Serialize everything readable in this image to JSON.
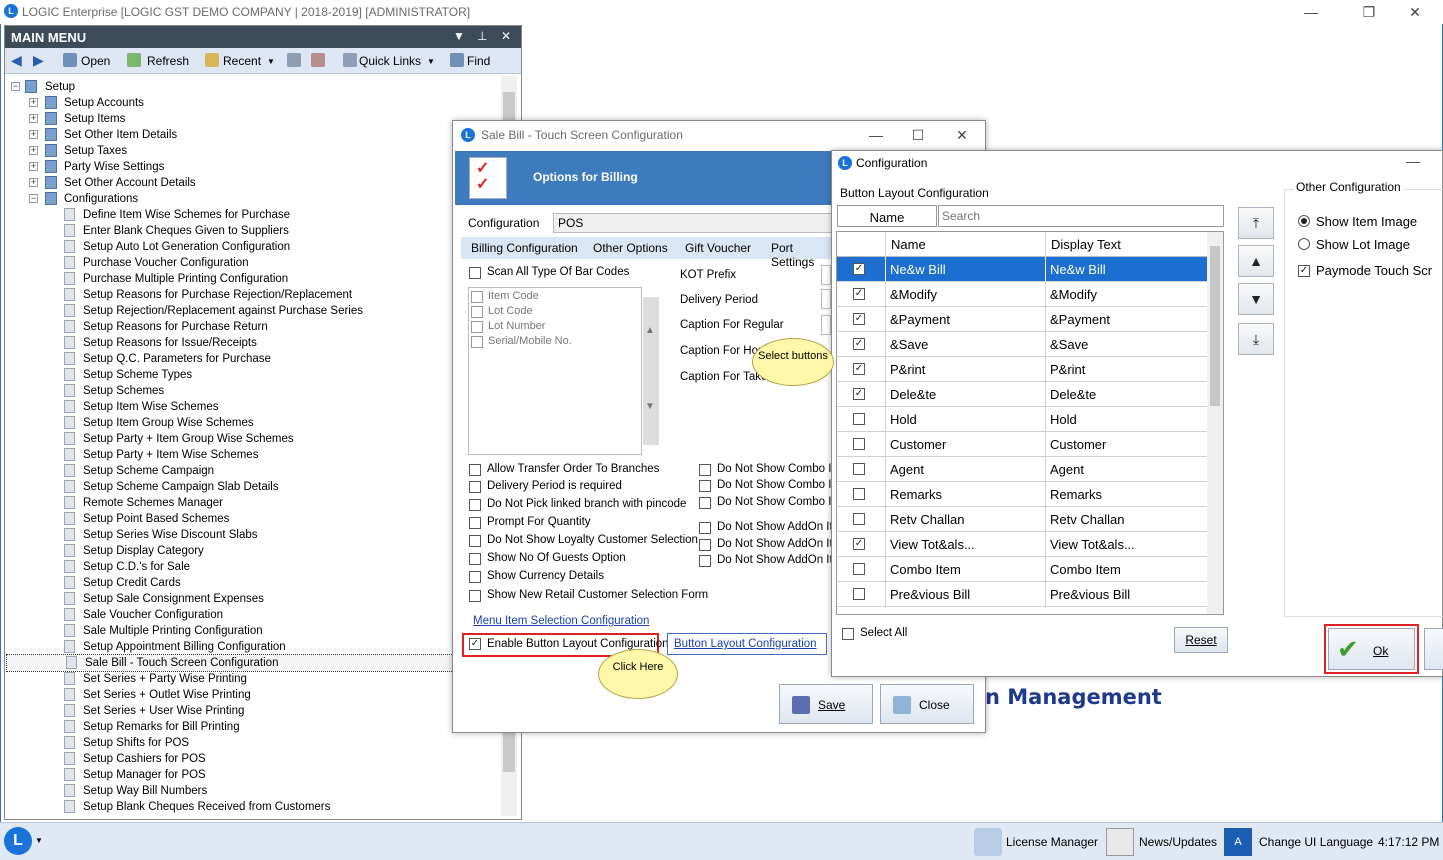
{
  "app": {
    "title": "LOGIC Enterprise [LOGIC GST DEMO COMPANY | 2018-2019] [ADMINISTRATOR]"
  },
  "main_menu": {
    "header": "MAIN MENU",
    "toolbar": {
      "open": "Open",
      "refresh": "Refresh",
      "recent": "Recent",
      "quick_links": "Quick Links",
      "find": "Find"
    },
    "root": "Setup",
    "setup_items": [
      "Setup Accounts",
      "Setup Items",
      "Set Other Item Details",
      "Setup Taxes",
      "Party Wise Settings",
      "Set Other Account Details"
    ],
    "configurations": "Configurations",
    "config_items": [
      "Define Item Wise Schemes for Purchase",
      "Enter Blank Cheques Given to Suppliers",
      "Setup Auto Lot Generation Configuration",
      "Purchase Voucher Configuration",
      "Purchase Multiple Printing Configuration",
      "Setup Reasons for Purchase Rejection/Replacement",
      "Setup Rejection/Replacement against Purchase Series",
      "Setup Reasons for Purchase Return",
      "Setup Reasons for Issue/Receipts",
      "Setup Q.C. Parameters for Purchase",
      "Setup Scheme Types",
      "Setup Schemes",
      "Setup Item Wise Schemes",
      "Setup Item Group Wise Schemes",
      "Setup Party + Item Group Wise Schemes",
      "Setup Party + Item Wise Schemes",
      "Setup Scheme Campaign",
      "Setup Scheme Campaign Slab Details",
      "Remote Schemes Manager",
      "Setup Point Based Schemes",
      "Setup Series Wise Discount Slabs",
      "Setup Display Category",
      "Setup C.D.'s for Sale",
      "Setup Credit Cards",
      "Setup Sale Consignment Expenses",
      "Sale Voucher Configuration",
      "Sale Multiple Printing Configuration",
      "Setup Appointment Billing Configuration",
      "Sale Bill - Touch Screen Configuration",
      "Set Series + Party Wise Printing",
      "Set Series + Outlet Wise Printing",
      "Set Series + User Wise Printing",
      "Setup Remarks for Bill Printing",
      "Setup Shifts for POS",
      "Setup Cashiers for POS",
      "Setup Manager for POS",
      "Setup Way Bill Numbers",
      "Setup Blank Cheques Received from Customers"
    ]
  },
  "sale_bill": {
    "title": "Sale Bill - Touch Screen Configuration",
    "banner": "Options for Billing",
    "config_label": "Configuration",
    "config_value": "POS",
    "tabs": [
      "Billing Configuration",
      "Other Options",
      "Gift Voucher",
      "Port Settings"
    ],
    "scan_all": "Scan All Type Of Bar Codes",
    "barcode_list": [
      "Item Code",
      "Lot Code",
      "Lot Number",
      "Serial/Mobile No."
    ],
    "right_labels": [
      "KOT Prefix",
      "Delivery Period",
      "Caption For Regular",
      "Caption For Home",
      "Caption For Take"
    ],
    "options_left": [
      "Allow Transfer Order To Branches",
      "Delivery Period is required",
      "Do Not Pick linked branch with pincode",
      "Prompt For Quantity",
      "Do Not Show Loyalty Customer Selection",
      "Show No Of Guests Option",
      "Show Currency Details",
      "Show New Retail Customer Selection Form"
    ],
    "options_right": [
      "Do Not Show Combo Ite",
      "Do Not Show Combo Ite",
      "Do Not Show Combo Ite",
      "Do Not Show AddOn Ite",
      "Do Not Show AddOn Ite",
      "Do Not Show AddOn Ite"
    ],
    "menu_link": "Menu Item Selection Configuration",
    "enable_label": "Enable Button Layout Configuration",
    "layout_link": "Button Layout Configuration",
    "save": "Save",
    "close": "Close",
    "callout_click": "Click Here",
    "callout_select": "Select buttons"
  },
  "config_dialog": {
    "title": "Configuration",
    "section": "Button Layout Configuration",
    "name_header": "Name",
    "search_placeholder": "Search",
    "col_name": "Name",
    "col_display": "Display Text",
    "rows": [
      {
        "name": "Ne&w Bill",
        "display": "Ne&w Bill",
        "checked": true,
        "selected": true
      },
      {
        "name": "&Modify",
        "display": "&Modify",
        "checked": true
      },
      {
        "name": "&Payment",
        "display": "&Payment",
        "checked": true
      },
      {
        "name": "&Save",
        "display": "&Save",
        "checked": true
      },
      {
        "name": "P&rint",
        "display": "P&rint",
        "checked": true
      },
      {
        "name": "Dele&te",
        "display": "Dele&te",
        "checked": true
      },
      {
        "name": "Hold",
        "display": "Hold",
        "checked": false
      },
      {
        "name": "Customer",
        "display": "Customer",
        "checked": false
      },
      {
        "name": "Agent",
        "display": "Agent",
        "checked": false
      },
      {
        "name": "Remarks",
        "display": "Remarks",
        "checked": false
      },
      {
        "name": "Retv Challan",
        "display": "Retv Challan",
        "checked": false
      },
      {
        "name": "View Tot&als...",
        "display": "View Tot&als...",
        "checked": true
      },
      {
        "name": "Combo Item",
        "display": "Combo Item",
        "checked": false
      },
      {
        "name": "Pre&vious Bill",
        "display": "Pre&vious Bill",
        "checked": false
      }
    ],
    "select_all": "Select All",
    "reset": "Reset",
    "other_config": "Other Configuration",
    "show_item_image": "Show Item Image",
    "show_lot_image": "Show Lot Image",
    "paymode_touch": "Paymode Touch Scr",
    "ok": "Ok"
  },
  "background_text": "n Management",
  "taskbar": {
    "license": "License Manager",
    "news": "News/Updates",
    "change_lang": "Change UI Language",
    "time": "4:17:12 PM"
  }
}
